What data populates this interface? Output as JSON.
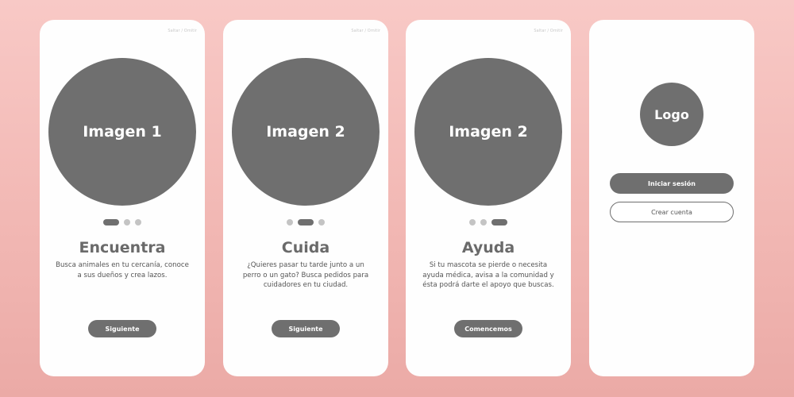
{
  "screens": [
    {
      "skip_label": "Saltar / Omitir",
      "image_label": "Imagen 1",
      "active_dot": 0,
      "title": "Encuentra",
      "description": "Busca animales en tu cercanía, conoce a sus dueños y crea lazos.",
      "button_label": "Siguiente"
    },
    {
      "skip_label": "Saltar / Omitir",
      "image_label": "Imagen 2",
      "active_dot": 1,
      "title": "Cuida",
      "description": "¿Quieres pasar tu tarde junto a un perro o un gato? Busca pedidos para cuidadores en tu ciudad.",
      "button_label": "Siguiente"
    },
    {
      "skip_label": "Saltar / Omitir",
      "image_label": "Imagen 2",
      "active_dot": 2,
      "title": "Ayuda",
      "description": "Si tu mascota se pierde o necesita ayuda médica, avisa a la comunidad y ésta podrá darte el apoyo que buscas.",
      "button_label": "Comencemos"
    }
  ],
  "login_screen": {
    "logo_label": "Logo",
    "login_button": "Iniciar sesión",
    "create_account_button": "Crear cuenta"
  },
  "colors": {
    "background": "#f2b8b4",
    "card": "#fefefe",
    "primary_gray": "#6f6f6f",
    "dot_inactive": "#c4c4c4"
  }
}
